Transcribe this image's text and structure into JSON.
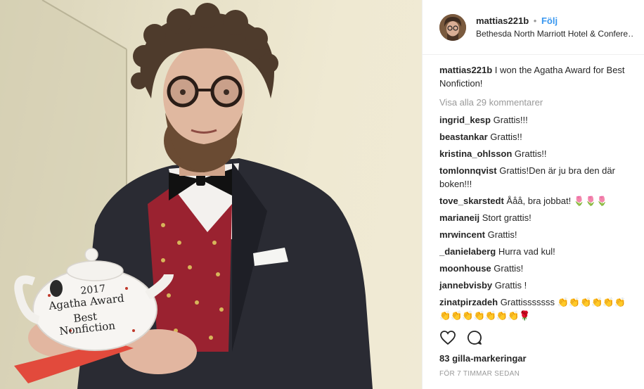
{
  "post": {
    "username": "mattias221b",
    "separator": "•",
    "follow_label": "Följ",
    "location": "Bethesda North Marriott Hotel & Confere…",
    "caption_user": "mattias221b",
    "caption_text": " I won the Agatha Award for Best Nonfiction!",
    "view_all": "Visa alla 29 kommentarer",
    "likes": "83 gilla-markeringar",
    "timestamp": "FÖR 7 TIMMAR SEDAN",
    "teapot_text": [
      "2017",
      "Agatha Award",
      "Best",
      "Nonfiction"
    ]
  },
  "comments": [
    {
      "user": "ingrid_kesp",
      "text": " Grattis!!!"
    },
    {
      "user": "beastankar",
      "text": " Grattis!!"
    },
    {
      "user": "kristina_ohlsson",
      "text": " Grattis!!"
    },
    {
      "user": "tomlonnqvist",
      "text": " Grattis!Den är ju bra den där boken!!!"
    },
    {
      "user": "tove_skarstedt",
      "text": " Ååå, bra jobbat! 🌷🌷🌷"
    },
    {
      "user": "marianeij",
      "text": " Stort grattis!"
    },
    {
      "user": "mrwincent",
      "text": " Grattis!"
    },
    {
      "user": "_danielaberg",
      "text": " Hurra vad kul!"
    },
    {
      "user": "moonhouse",
      "text": " Grattis!"
    },
    {
      "user": "jannebvisby",
      "text": " Grattis !"
    },
    {
      "user": "zinatpirzadeh",
      "text": " Grattisssssss 👏👏👏👏👏👏👏👏👏👏👏👏👏🌹"
    }
  ],
  "icons": {
    "like": "heart-icon",
    "comment": "comment-bubble-icon"
  },
  "colors": {
    "link": "#3897f0",
    "muted": "#999999",
    "text": "#262626",
    "border": "#efefef"
  }
}
